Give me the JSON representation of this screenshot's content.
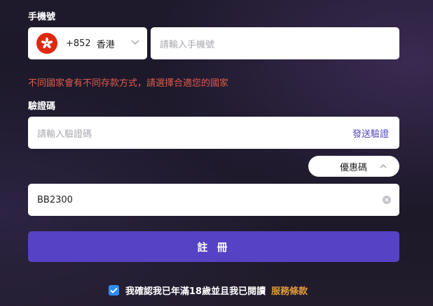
{
  "phone_section": {
    "label": "手機號",
    "country_code": "+852",
    "country_name": "香港",
    "phone_placeholder": "請輸入手機號",
    "warning": "不同國家會有不同存款方式，請選擇合適您的國家"
  },
  "verification": {
    "label": "驗證碼",
    "placeholder": "請輸入驗證碼",
    "send_label": "發送驗證"
  },
  "promo": {
    "toggle_label": "優惠碼",
    "value": "BB2300"
  },
  "submit_label": "註 冊",
  "agreement": {
    "text": "我確認我已年滿18歲並且我已閱讀",
    "link": "服務條款",
    "checked": true
  },
  "colors": {
    "accent": "#5642c4",
    "warning": "#e05a4c",
    "link": "#e29a3c",
    "checkbox": "#2f8cf0"
  },
  "icons": {
    "flag": "hong-kong-flag-icon",
    "dropdown": "chevron-down-icon",
    "collapse": "chevron-up-icon",
    "clear": "clear-icon",
    "checkbox": "check-icon"
  }
}
